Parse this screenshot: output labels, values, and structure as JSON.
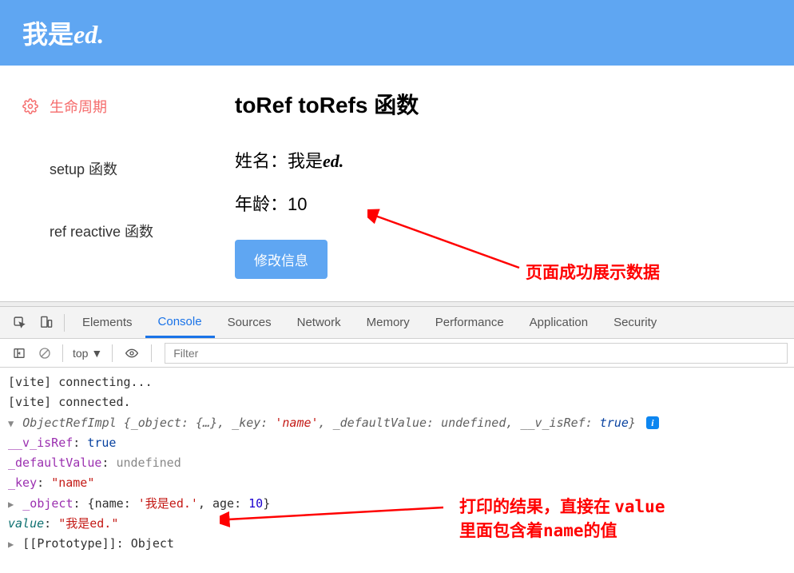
{
  "header": {
    "title_prefix": "我是",
    "title_suffix": "ed."
  },
  "sidebar": {
    "items": [
      {
        "label": "生命周期",
        "active": true
      },
      {
        "label": "setup 函数",
        "active": false
      },
      {
        "label": "ref reactive 函数",
        "active": false
      }
    ]
  },
  "main": {
    "title": "toRef toRefs 函数",
    "name_label": "姓名：",
    "name_value_prefix": "我是",
    "name_value_suffix": "ed.",
    "age_label": "年龄：",
    "age_value": "10",
    "button": "修改信息"
  },
  "annotations": {
    "top": "页面成功展示数据",
    "bottom_line1a": "打印的结果，直接在 ",
    "bottom_line1b": "value",
    "bottom_line2a": "里面包含着",
    "bottom_line2b": "name",
    "bottom_line2c": "的值"
  },
  "devtools": {
    "tabs": [
      "Elements",
      "Console",
      "Sources",
      "Network",
      "Memory",
      "Performance",
      "Application",
      "Security"
    ],
    "active_tab": "Console",
    "context": "top",
    "filter_placeholder": "Filter",
    "logs": {
      "l1": "[vite] connecting...",
      "l2": "[vite] connected.",
      "obj_type": "ObjectRefImpl",
      "obj_summary_pre": " {_object: {…}, _key: ",
      "obj_summary_key": "'name'",
      "obj_summary_mid": ", _defaultValue: ",
      "obj_summary_undef": "undefined",
      "obj_summary_end": ", __v_isRef: ",
      "obj_summary_true": "true",
      "k_isref": "__v_isRef",
      "v_isref": "true",
      "k_default": "_defaultValue",
      "v_default": "undefined",
      "k_key": "_key",
      "v_key": "\"name\"",
      "k_object": "_object",
      "v_obj_open": "{name: ",
      "v_obj_name": "'我是ed.'",
      "v_obj_mid": ", age: ",
      "v_obj_age": "10",
      "v_obj_close": "}",
      "k_value": "value",
      "v_value": "\"我是ed.\"",
      "k_proto": "[[Prototype]]",
      "v_proto": "Object"
    }
  }
}
